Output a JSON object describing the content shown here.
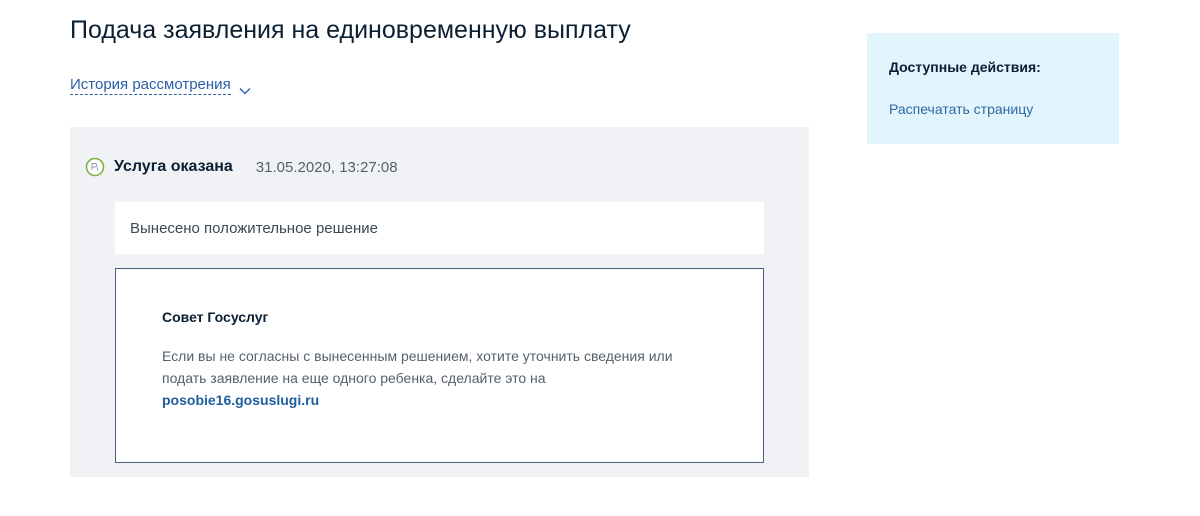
{
  "page": {
    "title": "Подача заявления на единовременную выплату"
  },
  "history": {
    "toggle_label": "История рассмотрения",
    "toggle_icon": "chevron-down-icon"
  },
  "event": {
    "status": "Услуга оказана",
    "timestamp": "31.05.2020, 13:27:08",
    "status_icon": "status-check-icon",
    "status_color": "#7cb342",
    "decision": "Вынесено положительное решение"
  },
  "advice": {
    "title": "Совет Госуслуг",
    "line1": "Если вы не согласны с вынесенным решением, хотите уточнить сведения или",
    "line2": "подать заявление на еще одного ребенка, сделайте это на",
    "link_text": "posobie16.gosuslugi.ru"
  },
  "actions": {
    "title": "Доступные действия:",
    "print_label": "Распечатать страницу"
  },
  "colors": {
    "panel_bg": "#f1f2f5",
    "actions_bg": "#e2f4fc",
    "link": "#2b5ea8"
  }
}
